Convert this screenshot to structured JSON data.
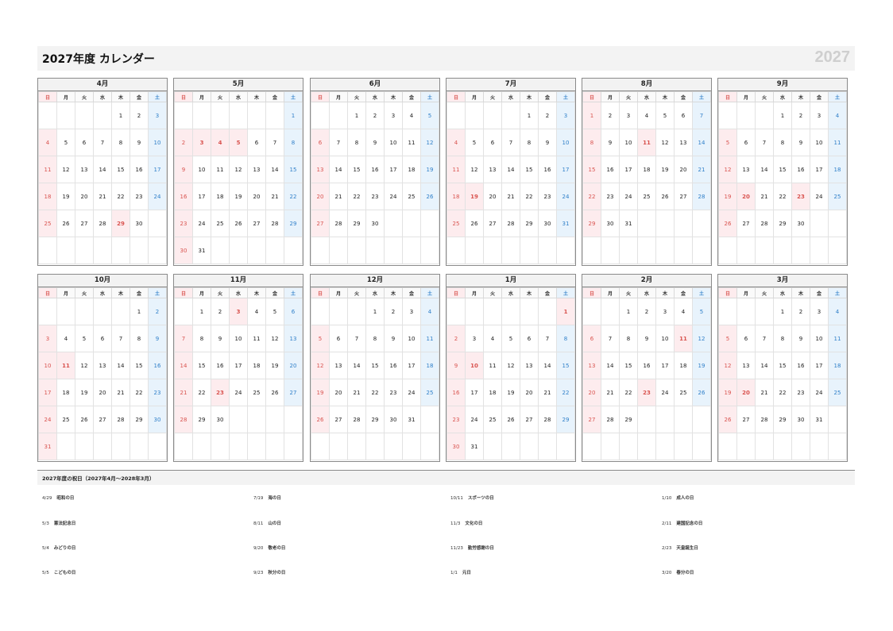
{
  "header": {
    "title": "2027年度 カレンダー",
    "year": "2027"
  },
  "weekday_labels": [
    "日",
    "月",
    "火",
    "水",
    "木",
    "金",
    "土"
  ],
  "months": [
    {
      "name": "4月",
      "start": 4,
      "days": 30,
      "holidays": [
        29
      ]
    },
    {
      "name": "5月",
      "start": 6,
      "days": 31,
      "holidays": [
        3,
        4,
        5
      ]
    },
    {
      "name": "6月",
      "start": 2,
      "days": 30,
      "holidays": []
    },
    {
      "name": "7月",
      "start": 4,
      "days": 31,
      "holidays": [
        19
      ]
    },
    {
      "name": "8月",
      "start": 0,
      "days": 31,
      "holidays": [
        11
      ]
    },
    {
      "name": "9月",
      "start": 3,
      "days": 30,
      "holidays": [
        20,
        23
      ]
    },
    {
      "name": "10月",
      "start": 5,
      "days": 31,
      "holidays": [
        11
      ]
    },
    {
      "name": "11月",
      "start": 1,
      "days": 30,
      "holidays": [
        3,
        23
      ]
    },
    {
      "name": "12月",
      "start": 3,
      "days": 31,
      "holidays": []
    },
    {
      "name": "1月",
      "start": 6,
      "days": 31,
      "holidays": [
        1,
        10
      ]
    },
    {
      "name": "2月",
      "start": 2,
      "days": 29,
      "holidays": [
        11,
        23
      ]
    },
    {
      "name": "3月",
      "start": 3,
      "days": 31,
      "holidays": [
        20
      ]
    }
  ],
  "holidays_section": {
    "title": "2027年度の祝日（2027年4月～2028年3月）",
    "items": [
      {
        "date": "4/29",
        "name": "昭和の日"
      },
      {
        "date": "5/3",
        "name": "憲法記念日"
      },
      {
        "date": "5/4",
        "name": "みどりの日"
      },
      {
        "date": "5/5",
        "name": "こどもの日"
      },
      {
        "date": "7/19",
        "name": "海の日"
      },
      {
        "date": "8/11",
        "name": "山の日"
      },
      {
        "date": "9/20",
        "name": "敬老の日"
      },
      {
        "date": "9/23",
        "name": "秋分の日"
      },
      {
        "date": "10/11",
        "name": "スポーツの日"
      },
      {
        "date": "11/3",
        "name": "文化の日"
      },
      {
        "date": "11/23",
        "name": "勤労感謝の日"
      },
      {
        "date": "1/1",
        "name": "元日"
      },
      {
        "date": "1/10",
        "name": "成人の日"
      },
      {
        "date": "2/11",
        "name": "建国記念の日"
      },
      {
        "date": "2/23",
        "name": "天皇誕生日"
      },
      {
        "date": "3/20",
        "name": "春分の日"
      }
    ]
  }
}
